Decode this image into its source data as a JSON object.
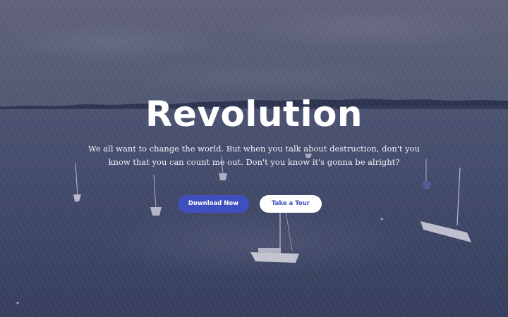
{
  "hero": {
    "title": "Revolution",
    "tagline": "We all want to change the world. But when you talk about destruction, don't you know that you can count me out. Don't you know it's gonna be alright?",
    "primary_button_label": "Download Now",
    "secondary_button_label": "Take a Tour"
  },
  "colors": {
    "accent": "#3f4fbd",
    "text": "#ffffff",
    "overlay": "#282c50"
  }
}
